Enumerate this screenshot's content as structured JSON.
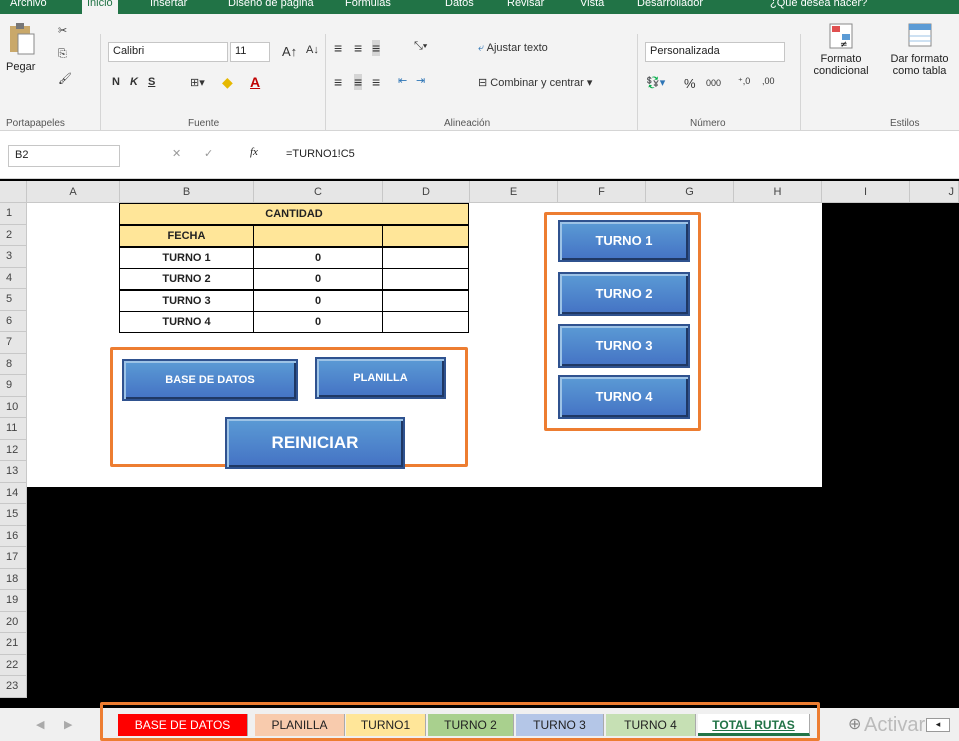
{
  "ribbon_tabs": [
    "Archivo",
    "Inicio",
    "Insertar",
    "Diseño de página",
    "Fórmulas",
    "Datos",
    "Revisar",
    "Vista",
    "Desarrollador",
    "¿Qué desea hacer?"
  ],
  "clipboard": {
    "paste_label": "Pegar",
    "group_label": "Portapapeles"
  },
  "font": {
    "name": "Calibri",
    "size": "11",
    "group_label": "Fuente",
    "bold": "N",
    "italic": "K",
    "underline": "S"
  },
  "alignment": {
    "wrap_label": "Ajustar texto",
    "merge_label": "Combinar y centrar",
    "group_label": "Alineación"
  },
  "number": {
    "format": "Personalizada",
    "group_label": "Número",
    "percent": "%",
    "thousands": "000"
  },
  "styles": {
    "conditional_label_1": "Formato",
    "conditional_label_2": "condicional",
    "table_label_1": "Dar formato",
    "table_label_2": "como tabla",
    "group_label": "Estilos"
  },
  "formula_bar": {
    "name_box": "B2",
    "fx": "fx",
    "formula": "=TURNO1!C5"
  },
  "columns": [
    "A",
    "B",
    "C",
    "D",
    "E",
    "F",
    "G",
    "H",
    "I",
    "J"
  ],
  "rows": [
    "1",
    "2",
    "3",
    "4",
    "5",
    "6",
    "7",
    "8",
    "9",
    "10",
    "11",
    "12",
    "13",
    "14",
    "15",
    "16",
    "17",
    "18",
    "19",
    "20",
    "21",
    "22",
    "23"
  ],
  "table": {
    "header": "CANTIDAD",
    "fecha": "FECHA",
    "rows": [
      {
        "label": "TURNO 1",
        "value": "0"
      },
      {
        "label": "TURNO 2",
        "value": "0"
      },
      {
        "label": "TURNO 3",
        "value": "0"
      },
      {
        "label": "TURNO 4",
        "value": "0"
      }
    ]
  },
  "buttons": {
    "base_datos": "BASE DE DATOS",
    "planilla": "PLANILLA",
    "reiniciar": "REINICIAR",
    "turno1": "TURNO 1",
    "turno2": "TURNO 2",
    "turno3": "TURNO 3",
    "turno4": "TURNO 4"
  },
  "sheet_tabs": [
    {
      "label": "BASE DE DATOS",
      "color": "#ff0000",
      "text": "#ffffff"
    },
    {
      "label": "PLANILLA",
      "color": "#f8cbad",
      "text": "#222222"
    },
    {
      "label": "TURNO1",
      "color": "#ffe699",
      "text": "#222222"
    },
    {
      "label": "TURNO 2",
      "color": "#a9d08e",
      "text": "#222222"
    },
    {
      "label": "TURNO 3",
      "color": "#b4c6e7",
      "text": "#222222"
    },
    {
      "label": "TURNO 4",
      "color": "#c6e0b4",
      "text": "#222222"
    },
    {
      "label": "TOTAL RUTAS",
      "color": "#ffffff",
      "text": "#217346"
    }
  ],
  "watermark": "Activar",
  "accent_color": "#217346",
  "highlight_color": "#ed7d31"
}
